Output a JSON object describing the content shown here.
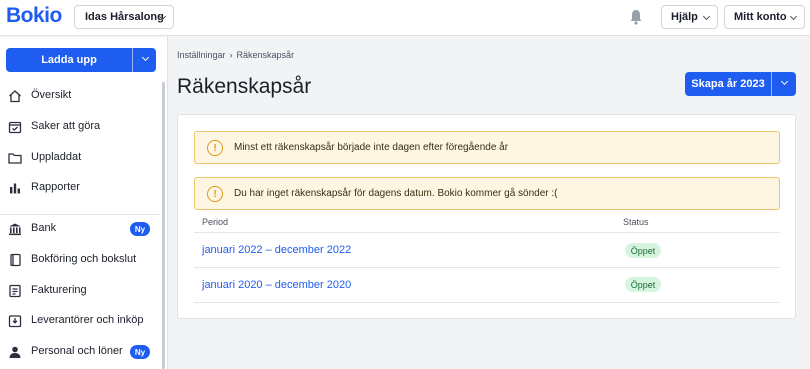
{
  "header": {
    "logo": "Bokio",
    "company": "Idas Hårsalong",
    "help": "Hjälp",
    "account": "Mitt konto"
  },
  "sidebar": {
    "upload_label": "Ladda upp",
    "items": [
      {
        "label": "Översikt",
        "icon": "home-icon"
      },
      {
        "label": "Saker att göra",
        "icon": "checklist-icon"
      },
      {
        "label": "Uppladdat",
        "icon": "folder-icon"
      },
      {
        "label": "Rapporter",
        "icon": "bar-chart-icon"
      },
      {
        "label": "Bank",
        "icon": "bank-icon",
        "badge": "Ny"
      },
      {
        "label": "Bokföring och bokslut",
        "icon": "book-icon"
      },
      {
        "label": "Fakturering",
        "icon": "invoice-icon"
      },
      {
        "label": "Leverantörer och inköp",
        "icon": "inbox-icon"
      },
      {
        "label": "Personal och löner",
        "icon": "person-icon",
        "badge": "Ny"
      }
    ]
  },
  "breadcrumb": {
    "parent": "Inställningar",
    "separator": "›",
    "current": "Räkenskapsår"
  },
  "page": {
    "title": "Räkenskapsår",
    "create_label": "Skapa år 2023"
  },
  "alerts": [
    {
      "icon": "warning-icon",
      "text": "Minst ett räkenskapsår började inte dagen efter föregående år"
    },
    {
      "icon": "warning-icon",
      "text": "Du har inget räkenskapsår för dagens datum. Bokio kommer gå sönder :("
    }
  ],
  "table": {
    "columns": [
      "Period",
      "Status"
    ],
    "rows": [
      {
        "period": "januari 2022 – december 2022",
        "status": "Öppet"
      },
      {
        "period": "januari 2020 – december 2020",
        "status": "Öppet"
      }
    ]
  },
  "colors": {
    "accent": "#1f5cf0",
    "warning_bg": "#fdf6e3",
    "warning_border": "#f1c36a",
    "status_bg": "#d6f5df"
  }
}
